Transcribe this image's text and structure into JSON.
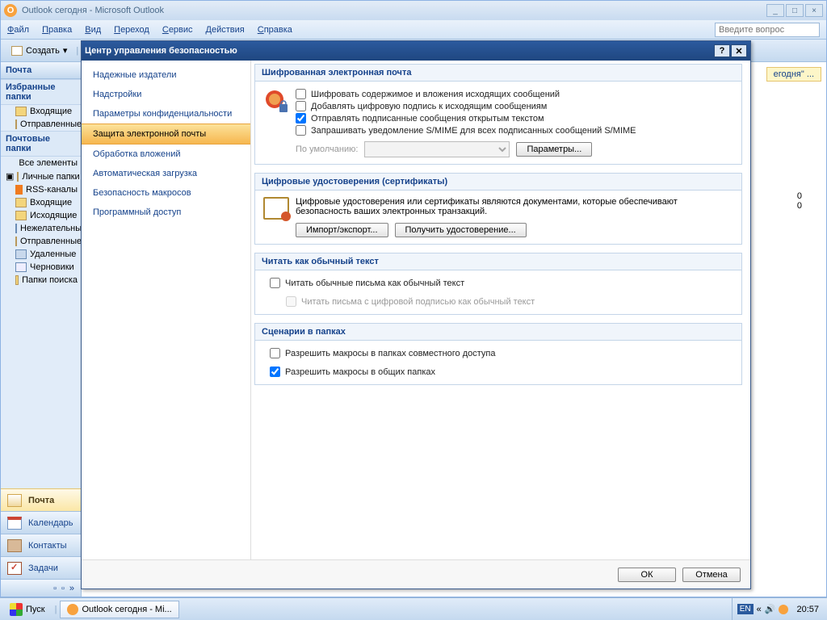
{
  "window": {
    "title": "Outlook сегодня - Microsoft Outlook",
    "today_button": "егодня\" ...",
    "zero1": "0",
    "zero2": "0"
  },
  "menu": {
    "file": "Файл",
    "edit": "Правка",
    "view": "Вид",
    "go": "Переход",
    "tools": "Сервис",
    "actions": "Действия",
    "help": "Справка",
    "question_placeholder": "Введите вопрос"
  },
  "toolbar": {
    "create": "Создать"
  },
  "nav": {
    "header": "Почта",
    "fav": "Избранные папки",
    "inbox": "Входящие",
    "sent": "Отправленные",
    "mailfolders": "Почтовые папки",
    "allitems": "Все элементы",
    "personal": "Личные папки",
    "rss": "RSS-каналы",
    "inbox2": "Входящие",
    "outgoing": "Исходящие",
    "junk": "Нежелательные",
    "sent2": "Отправленные",
    "deleted": "Удаленные",
    "drafts": "Черновики",
    "search": "Папки поиска",
    "b_mail": "Почта",
    "b_cal": "Календарь",
    "b_contacts": "Контакты",
    "b_tasks": "Задачи"
  },
  "dialog": {
    "title": "Центр управления безопасностью",
    "nav": {
      "publishers": "Надежные издатели",
      "addins": "Надстройки",
      "privacy": "Параметры конфиденциальности",
      "email_sec": "Защита электронной почты",
      "attachments": "Обработка вложений",
      "autodownload": "Автоматическая загрузка",
      "macro": "Безопасность макросов",
      "prog": "Программный доступ"
    },
    "g1": {
      "title": "Шифрованная электронная почта",
      "chk1": "Шифровать содержимое и вложения исходящих сообщений",
      "chk2": "Добавлять цифровую подпись к исходящим сообщениям",
      "chk3": "Отправлять подписанные сообщения открытым текстом",
      "chk4": "Запрашивать уведомление S/MIME для всех подписанных сообщений S/MIME",
      "default_label": "По умолчанию:",
      "params": "Параметры..."
    },
    "g2": {
      "title": "Цифровые удостоверения (сертификаты)",
      "desc": "Цифровые удостоверения или сертификаты являются документами, которые обеспечивают безопасность ваших электронных транзакций.",
      "import": "Импорт/экспорт...",
      "get": "Получить удостоверение..."
    },
    "g3": {
      "title": "Читать как обычный текст",
      "chk1": "Читать обычные письма как обычный текст",
      "chk2": "Читать письма с цифровой подписью как обычный текст"
    },
    "g4": {
      "title": "Сценарии в папках",
      "chk1": "Разрешить макросы в папках совместного доступа",
      "chk2": "Разрешить макросы в общих папках"
    },
    "ok": "ОК",
    "cancel": "Отмена"
  },
  "taskbar": {
    "start": "Пуск",
    "task": "Outlook сегодня - Mi...",
    "lang": "EN",
    "clock": "20:57"
  }
}
